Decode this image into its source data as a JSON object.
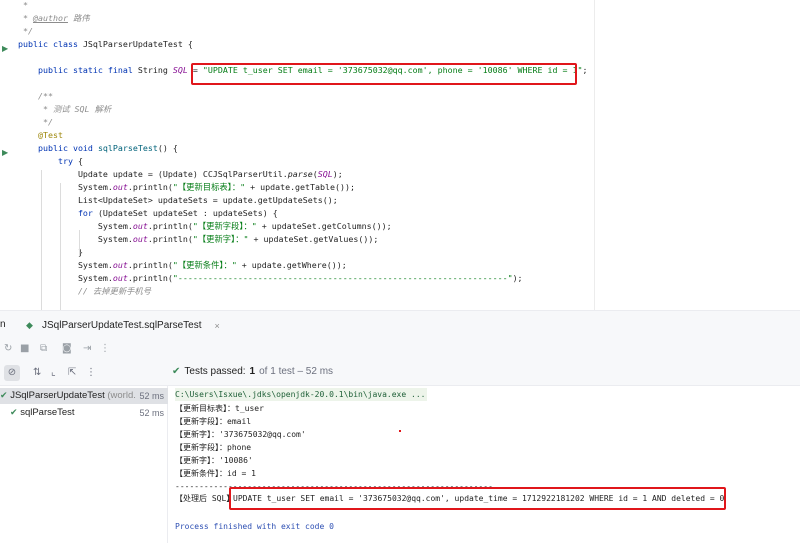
{
  "editor": {
    "lines": [
      {
        "segs": [
          {
            "t": " *",
            "c": "cm"
          }
        ]
      },
      {
        "segs": [
          {
            "t": " * ",
            "c": "cm"
          },
          {
            "t": "@author",
            "c": "cm-tag"
          },
          {
            "t": " 路伟",
            "c": "cm"
          }
        ]
      },
      {
        "segs": [
          {
            "t": " */",
            "c": "cm"
          }
        ]
      },
      {
        "segs": [
          {
            "t": "public class ",
            "c": "kw"
          },
          {
            "t": "JSqlParserUpdateTest {",
            "c": ""
          }
        ]
      },
      {
        "segs": []
      },
      {
        "segs": [
          {
            "t": "    public static final ",
            "c": "kw"
          },
          {
            "t": "String ",
            "c": ""
          },
          {
            "t": "SQL",
            "c": "fld"
          },
          {
            "t": " = ",
            "c": ""
          },
          {
            "t": "\"UPDATE t_user SET email = '373675032@qq.com', phone = '10086' WHERE id = 1\"",
            "c": "st"
          },
          {
            "t": ";",
            "c": ""
          }
        ]
      },
      {
        "segs": []
      },
      {
        "segs": [
          {
            "t": "    /**",
            "c": "cm"
          }
        ]
      },
      {
        "segs": [
          {
            "t": "     * 测试 SQL 解析",
            "c": "cm"
          }
        ]
      },
      {
        "segs": [
          {
            "t": "     */",
            "c": "cm"
          }
        ]
      },
      {
        "segs": [
          {
            "t": "    @Test",
            "c": "ann"
          }
        ]
      },
      {
        "segs": [
          {
            "t": "    public void ",
            "c": "kw"
          },
          {
            "t": "sqlParseTest",
            "c": "mth"
          },
          {
            "t": "() {",
            "c": ""
          }
        ]
      },
      {
        "segs": [
          {
            "t": "        try ",
            "c": "kw"
          },
          {
            "t": "{",
            "c": ""
          }
        ]
      },
      {
        "segs": [
          {
            "t": "            Update update = (Update) CCJSqlParserUtil.",
            "c": ""
          },
          {
            "t": "parse",
            "c": "itl"
          },
          {
            "t": "(",
            "c": ""
          },
          {
            "t": "SQL",
            "c": "fld"
          },
          {
            "t": ");",
            "c": ""
          }
        ]
      },
      {
        "segs": [
          {
            "t": "            System.",
            "c": ""
          },
          {
            "t": "out",
            "c": "fld"
          },
          {
            "t": ".println(",
            "c": ""
          },
          {
            "t": "\"【更新目标表】：\"",
            "c": "st"
          },
          {
            "t": " + update.getTable());",
            "c": ""
          }
        ]
      },
      {
        "segs": [
          {
            "t": "            List<UpdateSet> updateSets = update.getUpdateSets();",
            "c": ""
          }
        ]
      },
      {
        "segs": [
          {
            "t": "            for ",
            "c": "kw"
          },
          {
            "t": "(UpdateSet updateSet : updateSets) {",
            "c": ""
          }
        ]
      },
      {
        "segs": [
          {
            "t": "                System.",
            "c": ""
          },
          {
            "t": "out",
            "c": "fld"
          },
          {
            "t": ".println(",
            "c": ""
          },
          {
            "t": "\"【更新字段】：\"",
            "c": "st"
          },
          {
            "t": " + updateSet.getColumns());",
            "c": ""
          }
        ]
      },
      {
        "segs": [
          {
            "t": "                System.",
            "c": ""
          },
          {
            "t": "out",
            "c": "fld"
          },
          {
            "t": ".println(",
            "c": ""
          },
          {
            "t": "\"【更新字】：\"",
            "c": "st"
          },
          {
            "t": " + updateSet.getValues());",
            "c": ""
          }
        ]
      },
      {
        "segs": [
          {
            "t": "            }",
            "c": ""
          }
        ]
      },
      {
        "segs": [
          {
            "t": "            System.",
            "c": ""
          },
          {
            "t": "out",
            "c": "fld"
          },
          {
            "t": ".println(",
            "c": ""
          },
          {
            "t": "\"【更新条件】：\"",
            "c": "st"
          },
          {
            "t": " + update.getWhere());",
            "c": ""
          }
        ]
      },
      {
        "segs": [
          {
            "t": "            System.",
            "c": ""
          },
          {
            "t": "out",
            "c": "fld"
          },
          {
            "t": ".println(",
            "c": ""
          },
          {
            "t": "\"------------------------------------------------------------------\"",
            "c": "st"
          },
          {
            "t": ");",
            "c": ""
          }
        ]
      },
      {
        "segs": [
          {
            "t": "            // 去掉更新手机号",
            "c": "cm"
          }
        ]
      }
    ]
  },
  "run_panel": {
    "tab_run_label": "n",
    "tab_label": "JSqlParserUpdateTest.sqlParseTest",
    "tab_close": "×",
    "status": {
      "label": "Tests passed:",
      "count": "1",
      "rest": "of 1 test – 52 ms"
    }
  },
  "tree": {
    "items": [
      {
        "name": "JSqlParserUpdateTest",
        "note": "(world.",
        "duration": "52 ms"
      },
      {
        "name": "sqlParseTest",
        "note": "",
        "duration": "52 ms"
      }
    ]
  },
  "console": {
    "command": "C:\\Users\\Isxue\\.jdks\\openjdk-20.0.1\\bin\\java.exe ...",
    "lines": [
      "【更新目标表】：t_user",
      "【更新字段】：email",
      "【更新字】：'373675032@qq.com'",
      "【更新字段】：phone",
      "【更新字】：'10086'",
      "【更新条件】：id = 1",
      "------------------------------------------------------------------"
    ],
    "processed_label": "【处理后 SQL】",
    "processed_sql": "UPDATE t_user SET email = '373675032@qq.com', update_time = 1712922181202 WHERE id = 1 AND deleted = 0",
    "finished": "Process finished with exit code 0"
  },
  "colors": {
    "highlight_box": "#e0161b",
    "pass_green": "#3d8a5a",
    "keyword": "#0033b3",
    "string": "#067d17"
  }
}
